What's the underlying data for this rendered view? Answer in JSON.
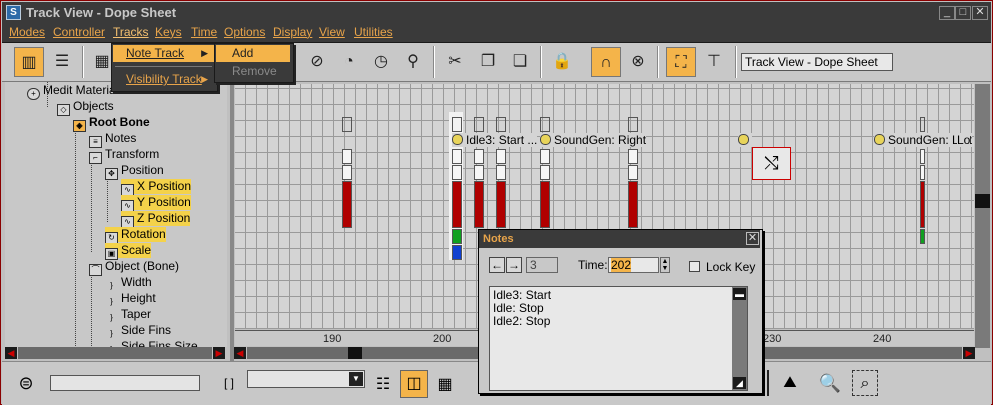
{
  "window": {
    "title": "Track View - Dope Sheet",
    "app_icon": "3ds-max-icon"
  },
  "menubar": [
    "Modes",
    "Controller",
    "Tracks",
    "Keys",
    "Time",
    "Options",
    "Display",
    "View",
    "Utilities"
  ],
  "tracks_menu": {
    "items": [
      "Note Track",
      "Visibility Track"
    ],
    "submenu": [
      "Add",
      "Remove"
    ]
  },
  "toolbar": {
    "name_field": "Track View - Dope Sheet"
  },
  "hierarchy": {
    "items": [
      "Medit Materials",
      "Objects",
      "Root Bone",
      "Notes",
      "Transform",
      "Position",
      "X Position",
      "Y Position",
      "Z Position",
      "Rotation",
      "Scale",
      "Object (Bone)",
      "Width",
      "Height",
      "Taper",
      "Side Fins",
      "Side Fins Size"
    ]
  },
  "grid": {
    "notes": [
      "Idle3: Start ...",
      "SoundGen: Right",
      "SoundGen: Left",
      "Lo"
    ],
    "ruler": [
      "190",
      "200",
      "230",
      "240"
    ]
  },
  "notes_dialog": {
    "title": "Notes",
    "index": "3",
    "time_label": "Time:",
    "time_value": "202",
    "lock_key_label": "Lock Key",
    "lines": [
      "Idle3: Start",
      "Idle: Stop",
      "Idle2: Stop"
    ]
  },
  "colors": {
    "accent": "#f4b44a",
    "menu_text": "#e8a44a",
    "key_red": "#b00000",
    "titlebar": "#3a3a3a"
  }
}
